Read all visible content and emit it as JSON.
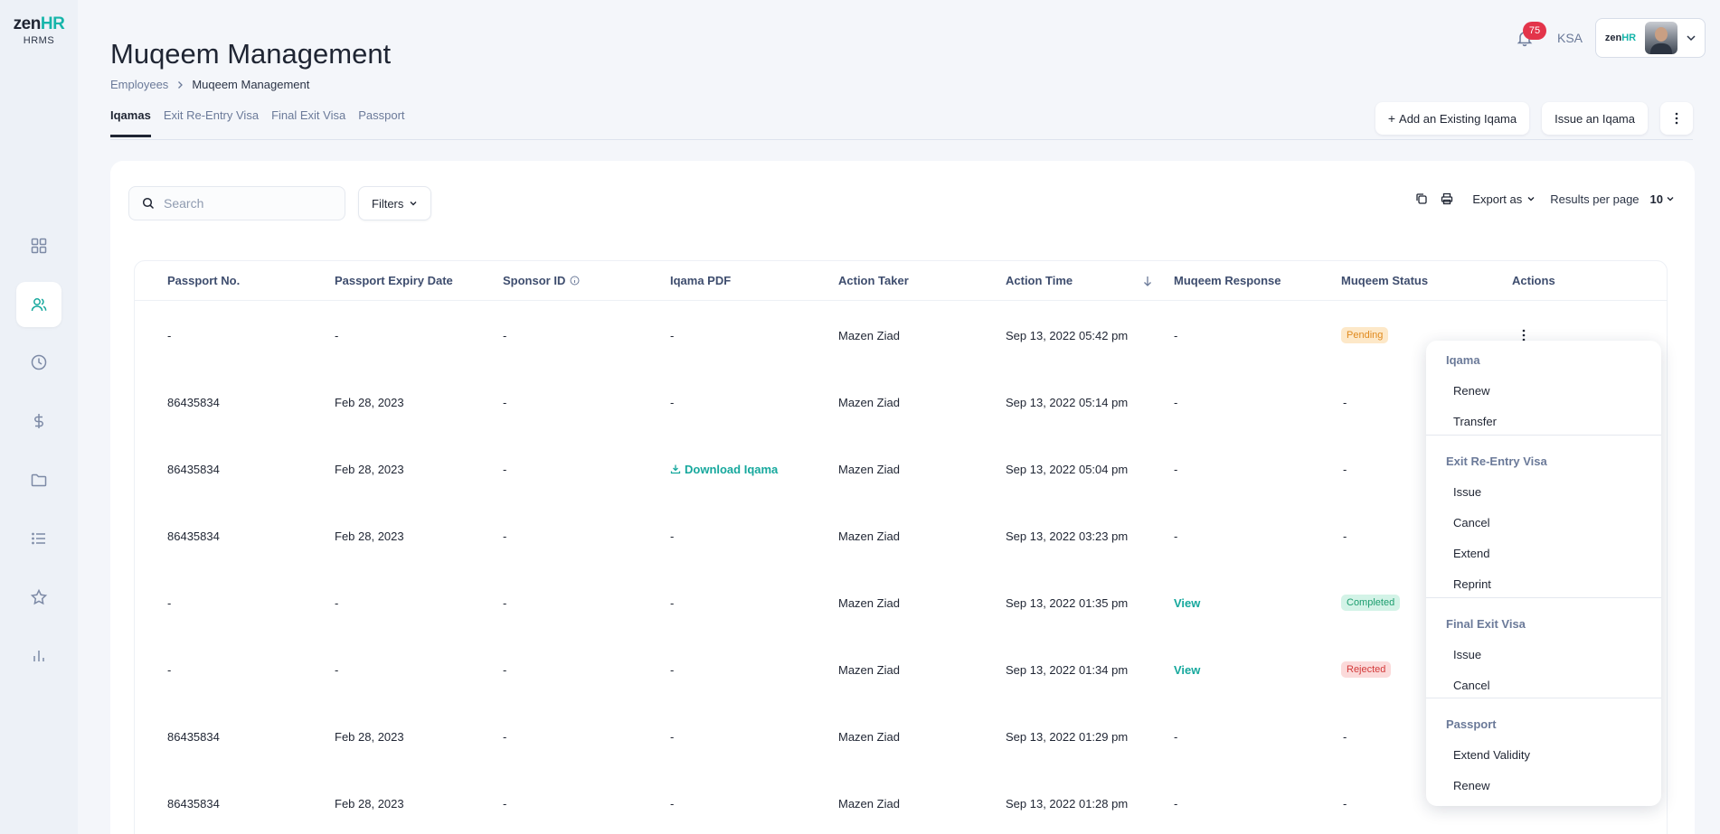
{
  "brand": {
    "logo_main": "zen",
    "logo_accent": "HR",
    "logo_sub": "HRMS"
  },
  "sidebar": {
    "items": [
      {
        "name": "dashboard",
        "icon": "grid-icon"
      },
      {
        "name": "employees",
        "icon": "users-icon",
        "active": true
      },
      {
        "name": "attendance",
        "icon": "clock-icon"
      },
      {
        "name": "payroll",
        "icon": "dollar-icon"
      },
      {
        "name": "documents",
        "icon": "folder-icon"
      },
      {
        "name": "lists",
        "icon": "list-icon"
      },
      {
        "name": "performance",
        "icon": "star-icon"
      },
      {
        "name": "reports",
        "icon": "bar-chart-icon"
      }
    ]
  },
  "header": {
    "title": "Muqeem Management",
    "breadcrumb": {
      "parent": "Employees",
      "current": "Muqeem Management"
    },
    "notification_count": "75",
    "region": "KSA",
    "company_logo_main": "zen",
    "company_logo_accent": "HR"
  },
  "tabs": [
    {
      "label": "Iqamas",
      "active": true
    },
    {
      "label": "Exit Re-Entry Visa"
    },
    {
      "label": "Final Exit Visa"
    },
    {
      "label": "Passport"
    }
  ],
  "actions": {
    "add_existing": "Add an Existing Iqama",
    "issue": "Issue an Iqama"
  },
  "toolbar": {
    "search_placeholder": "Search",
    "filters_label": "Filters",
    "export_label": "Export as",
    "results_label": "Results per page",
    "results_value": "10"
  },
  "table": {
    "columns": [
      "Passport No.",
      "Passport Expiry Date",
      "Sponsor ID",
      "Iqama PDF",
      "Action Taker",
      "Action Time",
      "Muqeem Response",
      "Muqeem Status",
      "Actions"
    ],
    "rows": [
      {
        "passport": "-",
        "expiry": "-",
        "sponsor": "-",
        "pdf": "-",
        "taker": "Mazen Ziad",
        "time": "Sep 13, 2022 05:42 pm",
        "response": "-",
        "status": "Pending"
      },
      {
        "passport": "86435834",
        "expiry": "Feb 28, 2023",
        "sponsor": "-",
        "pdf": "-",
        "taker": "Mazen Ziad",
        "time": "Sep 13, 2022 05:14 pm",
        "response": "-",
        "status": "-"
      },
      {
        "passport": "86435834",
        "expiry": "Feb 28, 2023",
        "sponsor": "-",
        "pdf": "Download Iqama",
        "taker": "Mazen Ziad",
        "time": "Sep 13, 2022 05:04 pm",
        "response": "-",
        "status": "-"
      },
      {
        "passport": "86435834",
        "expiry": "Feb 28, 2023",
        "sponsor": "-",
        "pdf": "-",
        "taker": "Mazen Ziad",
        "time": "Sep 13, 2022 03:23 pm",
        "response": "-",
        "status": "-"
      },
      {
        "passport": "-",
        "expiry": "-",
        "sponsor": "-",
        "pdf": "-",
        "taker": "Mazen Ziad",
        "time": "Sep 13, 2022 01:35 pm",
        "response": "View",
        "status": "Completed"
      },
      {
        "passport": "-",
        "expiry": "-",
        "sponsor": "-",
        "pdf": "-",
        "taker": "Mazen Ziad",
        "time": "Sep 13, 2022 01:34 pm",
        "response": "View",
        "status": "Rejected"
      },
      {
        "passport": "86435834",
        "expiry": "Feb 28, 2023",
        "sponsor": "-",
        "pdf": "-",
        "taker": "Mazen Ziad",
        "time": "Sep 13, 2022 01:29 pm",
        "response": "-",
        "status": "-"
      },
      {
        "passport": "86435834",
        "expiry": "Feb 28, 2023",
        "sponsor": "-",
        "pdf": "-",
        "taker": "Mazen Ziad",
        "time": "Sep 13, 2022 01:28 pm",
        "response": "-",
        "status": "-"
      }
    ]
  },
  "dropdown": {
    "sections": [
      {
        "header": "Iqama",
        "items": [
          "Renew",
          "Transfer"
        ]
      },
      {
        "header": "Exit Re-Entry Visa",
        "items": [
          "Issue",
          "Cancel",
          "Extend",
          "Reprint"
        ]
      },
      {
        "header": "Final Exit Visa",
        "items": [
          "Issue",
          "Cancel"
        ]
      },
      {
        "header": "Passport",
        "items": [
          "Extend Validity",
          "Renew"
        ]
      }
    ]
  },
  "colors": {
    "accent": "#16a89d",
    "pending": "#e08a1e",
    "completed": "#1c9d6e",
    "rejected": "#d33a3a",
    "badge_red": "#e3344a"
  }
}
